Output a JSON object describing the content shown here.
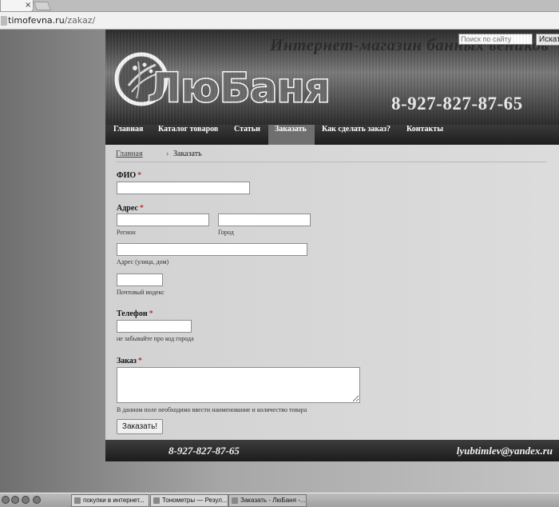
{
  "browser": {
    "tab_close": "×",
    "url_domain": "timofevna.ru",
    "url_path": "/zakaz/"
  },
  "header": {
    "tagline": "Интернет-магазин банных веников",
    "search_placeholder": "Поиск по сайту",
    "search_button": "Искать",
    "logo_text": "ЛюБаня",
    "phone": "8-927-827-87-65"
  },
  "nav": {
    "items": [
      {
        "label": "Главная"
      },
      {
        "label": "Каталог товаров"
      },
      {
        "label": "Статьи"
      },
      {
        "label": "Заказать"
      },
      {
        "label": "Как сделать заказ?"
      },
      {
        "label": "Контакты"
      }
    ]
  },
  "breadcrumb": {
    "home": "Главная",
    "separator": "›",
    "current": "Заказать"
  },
  "form": {
    "required_mark": "*",
    "fio_label": "ФИО",
    "address_label": "Адрес",
    "region_hint": "Регион",
    "city_hint": "Город",
    "street_hint": "Адрес (улица, дом)",
    "postcode_hint": "Почтовый индекс",
    "phone_label": "Телефон",
    "phone_hint": "не забывайте про код города",
    "order_label": "Заказ",
    "order_hint": "В данном поле необходимо ввести наименование и количество товара",
    "submit": "Заказать!"
  },
  "footer": {
    "phone": "8-927-827-87-65",
    "email": "lyubtimlev@yandex.ru"
  },
  "taskbar": {
    "items": [
      {
        "label": "покупки в интернет..."
      },
      {
        "label": "Тонометры — Резул..."
      },
      {
        "label": "Заказать - ЛюБаня -..."
      }
    ]
  }
}
